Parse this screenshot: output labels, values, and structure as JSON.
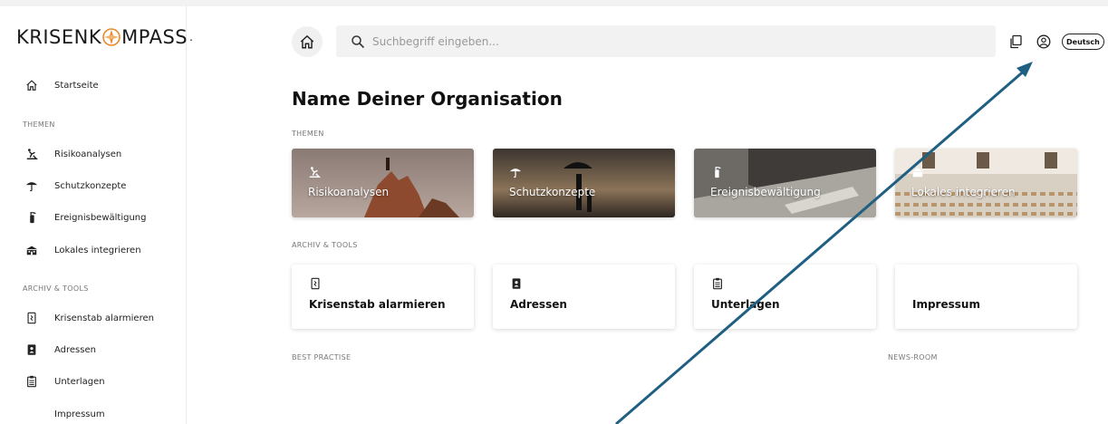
{
  "logo": {
    "left": "KRISENK",
    "right": "MPASS",
    "dot": "."
  },
  "sidebar": {
    "home": "Startseite",
    "section_themes": "THEMEN",
    "themes": [
      "Risikoanalysen",
      "Schutzkonzepte",
      "Ereignisbewältigung",
      "Lokales integrieren"
    ],
    "section_tools": "ARCHIV & TOOLS",
    "tools": [
      "Krisenstab alarmieren",
      "Adressen",
      "Unterlagen",
      "Impressum"
    ]
  },
  "header": {
    "search_placeholder": "Suchbegriff eingeben...",
    "language": "Deutsch"
  },
  "main": {
    "title": "Name Deiner Organisation",
    "section_themes": "THEMEN",
    "theme_cards": [
      "Risikoanalysen",
      "Schutzkonzepte",
      "Ereignisbewältigung",
      "Lokales integrieren"
    ],
    "section_tools": "ARCHIV & TOOLS",
    "tool_cards": [
      "Krisenstab alarmieren",
      "Adressen",
      "Unterlagen",
      "Impressum"
    ],
    "section_best": "BEST PRACTISE",
    "section_news": "NEWS-ROOM"
  },
  "colors": {
    "annotation_arrow": "#1f5f82",
    "logo_accent": "#e8892b"
  },
  "icons": {
    "home": "home-icon",
    "search": "search-icon",
    "copy": "copy-icon",
    "user": "user-circle-icon",
    "risk": "climber-icon",
    "protection": "umbrella-icon",
    "event": "extinguisher-icon",
    "local": "building-icon",
    "alarm": "phone-alert-icon",
    "addresses": "address-book-icon",
    "documents": "clipboard-icon"
  }
}
